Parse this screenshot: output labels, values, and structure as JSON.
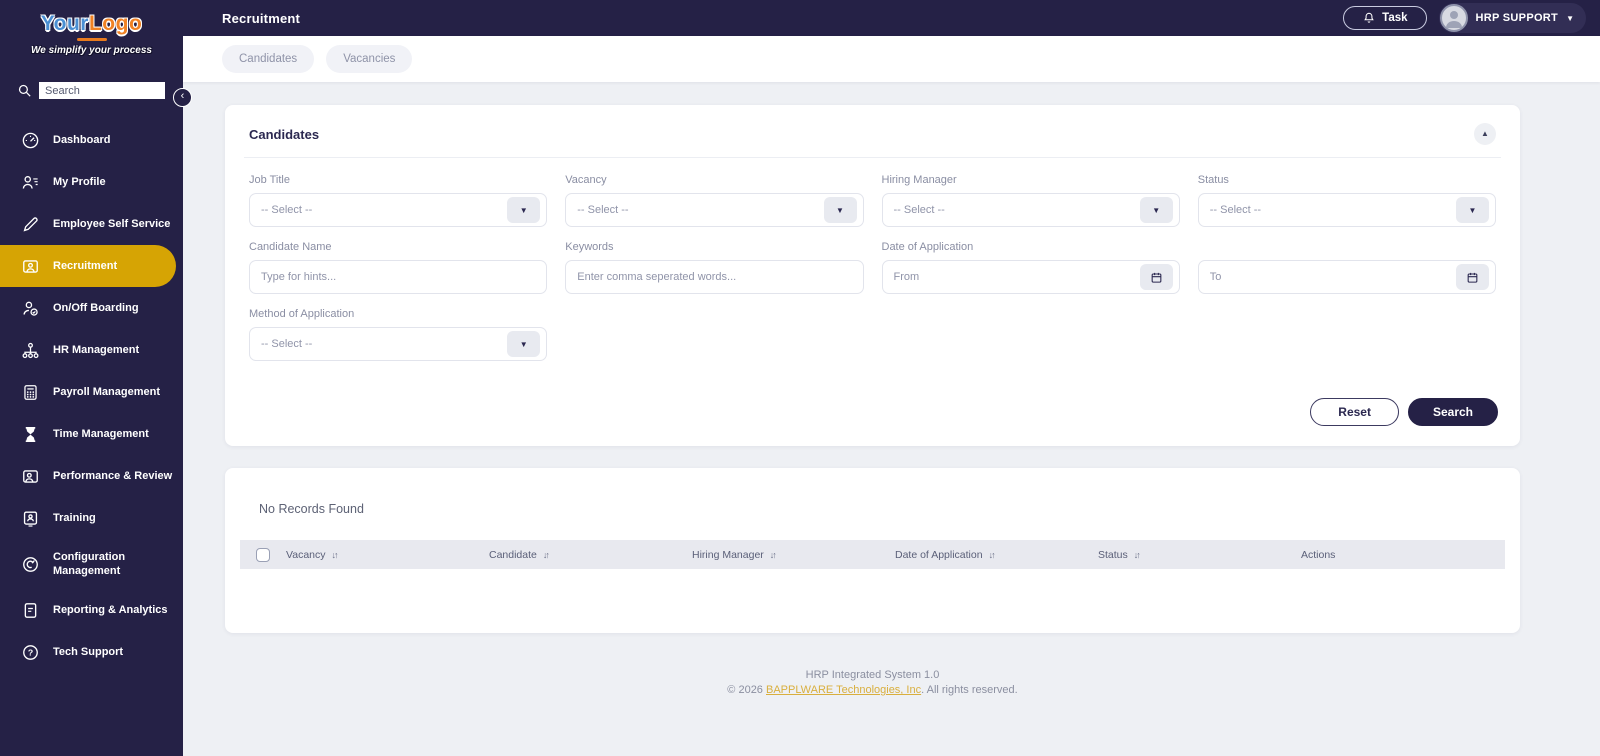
{
  "brand": {
    "logo_part1": "Your",
    "logo_part2": "Logo",
    "tagline": "We simplify your process"
  },
  "sidebar": {
    "search_placeholder": "Search",
    "items": [
      {
        "label": "Dashboard",
        "icon": "dashboard-gauge-icon",
        "active": false
      },
      {
        "label": "My Profile",
        "icon": "person-list-icon",
        "active": false
      },
      {
        "label": "Employee Self Service",
        "icon": "pen-icon",
        "active": false
      },
      {
        "label": "Recruitment",
        "icon": "folder-person-icon",
        "active": true
      },
      {
        "label": "On/Off Boarding",
        "icon": "person-check-icon",
        "active": false
      },
      {
        "label": "HR Management",
        "icon": "org-chart-icon",
        "active": false
      },
      {
        "label": "Payroll Management",
        "icon": "calculator-icon",
        "active": false
      },
      {
        "label": "Time Management",
        "icon": "hourglass-icon",
        "active": false
      },
      {
        "label": "Performance & Review",
        "icon": "folder-person-icon",
        "active": false
      },
      {
        "label": "Training",
        "icon": "presentation-icon",
        "active": false
      },
      {
        "label": "Configuration Management",
        "icon": "gear-tool-icon",
        "active": false
      },
      {
        "label": "Reporting & Analytics",
        "icon": "document-icon",
        "active": false
      },
      {
        "label": "Tech Support",
        "icon": "question-badge-icon",
        "active": false
      }
    ]
  },
  "topbar": {
    "title": "Recruitment",
    "task_button_label": "Task",
    "user_name": "HRP SUPPORT"
  },
  "tabs": [
    {
      "label": "Candidates"
    },
    {
      "label": "Vacancies"
    }
  ],
  "filter_card": {
    "title": "Candidates",
    "fields": {
      "job_title": {
        "label": "Job Title",
        "value": "-- Select --"
      },
      "vacancy": {
        "label": "Vacancy",
        "value": "-- Select --"
      },
      "hiring_manager": {
        "label": "Hiring Manager",
        "value": "-- Select --"
      },
      "status": {
        "label": "Status",
        "value": "-- Select --"
      },
      "candidate_name": {
        "label": "Candidate Name",
        "placeholder": "Type for hints..."
      },
      "keywords": {
        "label": "Keywords",
        "placeholder": "Enter comma seperated words..."
      },
      "date_of_application": {
        "label": "Date of Application",
        "from_placeholder": "From",
        "to_placeholder": "To"
      },
      "method_of_application": {
        "label": "Method of Application",
        "value": "-- Select --"
      }
    },
    "reset_label": "Reset",
    "search_label": "Search"
  },
  "results_card": {
    "empty_message": "No Records Found",
    "sort_glyph": "↓↑",
    "columns": [
      {
        "label": "Vacancy",
        "sortable": true
      },
      {
        "label": "Candidate",
        "sortable": true
      },
      {
        "label": "Hiring Manager",
        "sortable": true
      },
      {
        "label": "Date of Application",
        "sortable": true
      },
      {
        "label": "Status",
        "sortable": true
      },
      {
        "label": "Actions",
        "sortable": false
      }
    ],
    "rows": []
  },
  "footer": {
    "system_name": "HRP Integrated System 1.0",
    "copyright_prefix": "© 2026 ",
    "company_link": "BAPPLWARE Technologies, Inc",
    "copyright_suffix": ". All rights reserved."
  },
  "colors": {
    "navy": "#252146",
    "active_gold": "#d6a404",
    "logo_blue": "#4a8fd3",
    "logo_orange": "#f08224",
    "footer_link_gold": "#d9af3e",
    "content_bg": "#eef0f4"
  }
}
